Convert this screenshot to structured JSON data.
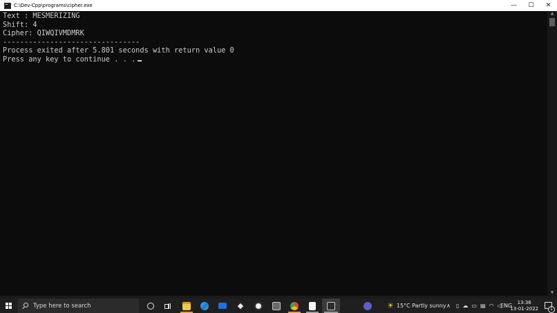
{
  "window": {
    "title": "C:\\Dev-Cpp\\programs\\cipher.exe",
    "controls": {
      "minimize": "—",
      "maximize": "☐",
      "close": "✕"
    }
  },
  "console": {
    "lines": [
      "Text : MESMERIZING",
      "Shift: 4",
      "Cipher: QIWQIVMDMRK",
      "--------------------------------",
      "Process exited after 5.801 seconds with return value 0",
      "Press any key to continue . . ."
    ]
  },
  "taskbar": {
    "search_placeholder": "Type here to search",
    "weather": "15°C  Partly sunny",
    "language": "ENG",
    "time": "13:36",
    "date": "13-01-2022",
    "notification_count": "1",
    "icons": [
      "start-icon",
      "search-icon",
      "cortana-icon",
      "task-view-icon",
      "file-explorer-icon",
      "edge-icon",
      "mail-icon",
      "dropbox-icon",
      "obs-icon",
      "dev-cpp-icon",
      "chrome-icon",
      "notepad-icon",
      "console-window-icon",
      "teams-icon"
    ]
  },
  "colors": {
    "console_bg": "#0c0c0c",
    "console_text": "#cccccc",
    "taskbar_bg": "#1f1f1f",
    "active_underline": "#d8a349"
  }
}
